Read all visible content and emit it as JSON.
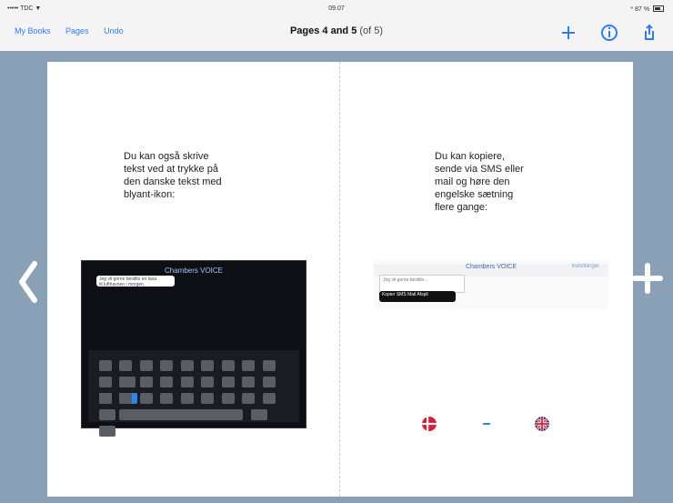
{
  "status_bar": {
    "carrier": "••••• TDC ▼",
    "time": "09.07",
    "battery": "* 87 %"
  },
  "nav": {
    "my_books": "My Books",
    "pages": "Pages",
    "undo": "Undo",
    "title_bold": "Pages 4 and 5",
    "title_light": " (of 5)",
    "icons": [
      "plus-icon",
      "info-icon",
      "share-icon"
    ]
  },
  "left_page": {
    "text": "Du kan også skrive\ntekst ved at trykke på\nden danske tekst med\nblyant-ikon:",
    "screenshot": {
      "brand": "Chambers VOICE",
      "message": "Jeg vil gerne bestille en taxa\ntil lufthavnen i morgen."
    }
  },
  "right_page": {
    "text": "Du kan kopiere,\nsende via SMS eller\nmail og høre den\nengelske sætning\nflere gange:",
    "screenshot": {
      "brand": "Chambers VOICE",
      "top_right": "Indstillinger",
      "edit_box": "Jeg vil gerne bestille...",
      "menu": "Kopier   SMS   Mail   Afspil"
    },
    "flags": [
      "danish-flag-icon",
      "uk-flag-icon"
    ]
  },
  "colors": {
    "accent": "#2d7cf6",
    "canvas": "#8aa0b6"
  }
}
